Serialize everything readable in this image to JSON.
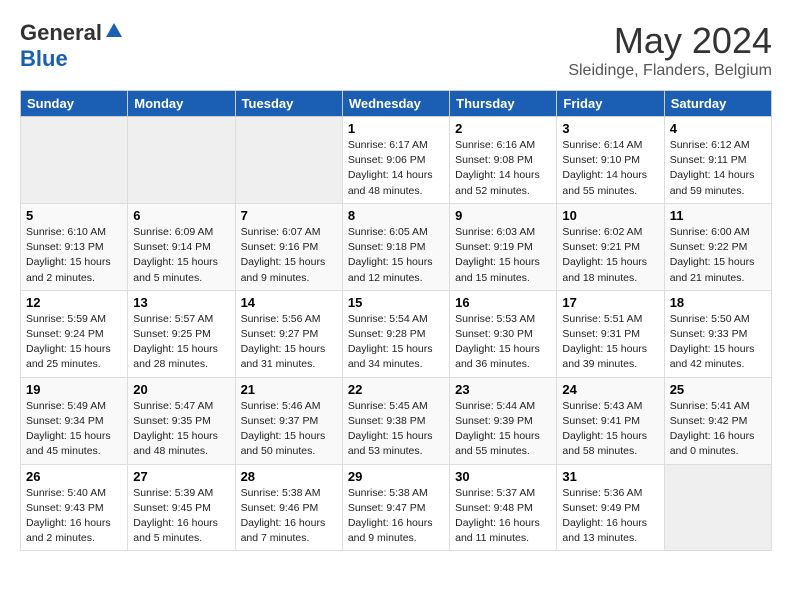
{
  "header": {
    "logo_general": "General",
    "logo_blue": "Blue",
    "month_year": "May 2024",
    "location": "Sleidinge, Flanders, Belgium"
  },
  "weekdays": [
    "Sunday",
    "Monday",
    "Tuesday",
    "Wednesday",
    "Thursday",
    "Friday",
    "Saturday"
  ],
  "weeks": [
    [
      {
        "day": "",
        "text": ""
      },
      {
        "day": "",
        "text": ""
      },
      {
        "day": "",
        "text": ""
      },
      {
        "day": "1",
        "text": "Sunrise: 6:17 AM\nSunset: 9:06 PM\nDaylight: 14 hours\nand 48 minutes."
      },
      {
        "day": "2",
        "text": "Sunrise: 6:16 AM\nSunset: 9:08 PM\nDaylight: 14 hours\nand 52 minutes."
      },
      {
        "day": "3",
        "text": "Sunrise: 6:14 AM\nSunset: 9:10 PM\nDaylight: 14 hours\nand 55 minutes."
      },
      {
        "day": "4",
        "text": "Sunrise: 6:12 AM\nSunset: 9:11 PM\nDaylight: 14 hours\nand 59 minutes."
      }
    ],
    [
      {
        "day": "5",
        "text": "Sunrise: 6:10 AM\nSunset: 9:13 PM\nDaylight: 15 hours\nand 2 minutes."
      },
      {
        "day": "6",
        "text": "Sunrise: 6:09 AM\nSunset: 9:14 PM\nDaylight: 15 hours\nand 5 minutes."
      },
      {
        "day": "7",
        "text": "Sunrise: 6:07 AM\nSunset: 9:16 PM\nDaylight: 15 hours\nand 9 minutes."
      },
      {
        "day": "8",
        "text": "Sunrise: 6:05 AM\nSunset: 9:18 PM\nDaylight: 15 hours\nand 12 minutes."
      },
      {
        "day": "9",
        "text": "Sunrise: 6:03 AM\nSunset: 9:19 PM\nDaylight: 15 hours\nand 15 minutes."
      },
      {
        "day": "10",
        "text": "Sunrise: 6:02 AM\nSunset: 9:21 PM\nDaylight: 15 hours\nand 18 minutes."
      },
      {
        "day": "11",
        "text": "Sunrise: 6:00 AM\nSunset: 9:22 PM\nDaylight: 15 hours\nand 21 minutes."
      }
    ],
    [
      {
        "day": "12",
        "text": "Sunrise: 5:59 AM\nSunset: 9:24 PM\nDaylight: 15 hours\nand 25 minutes."
      },
      {
        "day": "13",
        "text": "Sunrise: 5:57 AM\nSunset: 9:25 PM\nDaylight: 15 hours\nand 28 minutes."
      },
      {
        "day": "14",
        "text": "Sunrise: 5:56 AM\nSunset: 9:27 PM\nDaylight: 15 hours\nand 31 minutes."
      },
      {
        "day": "15",
        "text": "Sunrise: 5:54 AM\nSunset: 9:28 PM\nDaylight: 15 hours\nand 34 minutes."
      },
      {
        "day": "16",
        "text": "Sunrise: 5:53 AM\nSunset: 9:30 PM\nDaylight: 15 hours\nand 36 minutes."
      },
      {
        "day": "17",
        "text": "Sunrise: 5:51 AM\nSunset: 9:31 PM\nDaylight: 15 hours\nand 39 minutes."
      },
      {
        "day": "18",
        "text": "Sunrise: 5:50 AM\nSunset: 9:33 PM\nDaylight: 15 hours\nand 42 minutes."
      }
    ],
    [
      {
        "day": "19",
        "text": "Sunrise: 5:49 AM\nSunset: 9:34 PM\nDaylight: 15 hours\nand 45 minutes."
      },
      {
        "day": "20",
        "text": "Sunrise: 5:47 AM\nSunset: 9:35 PM\nDaylight: 15 hours\nand 48 minutes."
      },
      {
        "day": "21",
        "text": "Sunrise: 5:46 AM\nSunset: 9:37 PM\nDaylight: 15 hours\nand 50 minutes."
      },
      {
        "day": "22",
        "text": "Sunrise: 5:45 AM\nSunset: 9:38 PM\nDaylight: 15 hours\nand 53 minutes."
      },
      {
        "day": "23",
        "text": "Sunrise: 5:44 AM\nSunset: 9:39 PM\nDaylight: 15 hours\nand 55 minutes."
      },
      {
        "day": "24",
        "text": "Sunrise: 5:43 AM\nSunset: 9:41 PM\nDaylight: 15 hours\nand 58 minutes."
      },
      {
        "day": "25",
        "text": "Sunrise: 5:41 AM\nSunset: 9:42 PM\nDaylight: 16 hours\nand 0 minutes."
      }
    ],
    [
      {
        "day": "26",
        "text": "Sunrise: 5:40 AM\nSunset: 9:43 PM\nDaylight: 16 hours\nand 2 minutes."
      },
      {
        "day": "27",
        "text": "Sunrise: 5:39 AM\nSunset: 9:45 PM\nDaylight: 16 hours\nand 5 minutes."
      },
      {
        "day": "28",
        "text": "Sunrise: 5:38 AM\nSunset: 9:46 PM\nDaylight: 16 hours\nand 7 minutes."
      },
      {
        "day": "29",
        "text": "Sunrise: 5:38 AM\nSunset: 9:47 PM\nDaylight: 16 hours\nand 9 minutes."
      },
      {
        "day": "30",
        "text": "Sunrise: 5:37 AM\nSunset: 9:48 PM\nDaylight: 16 hours\nand 11 minutes."
      },
      {
        "day": "31",
        "text": "Sunrise: 5:36 AM\nSunset: 9:49 PM\nDaylight: 16 hours\nand 13 minutes."
      },
      {
        "day": "",
        "text": ""
      }
    ]
  ]
}
